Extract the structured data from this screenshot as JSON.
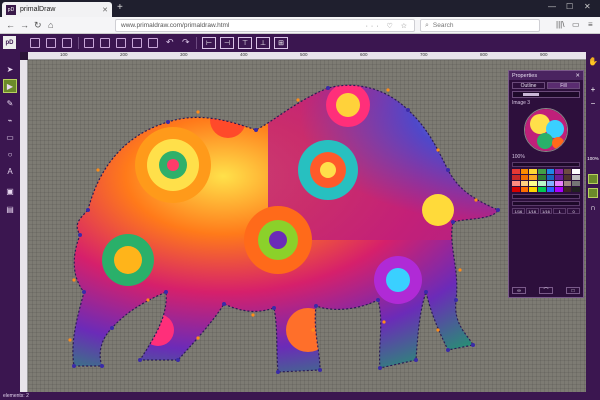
{
  "browser": {
    "tab_title": "primalDraw",
    "tab_close": "✕",
    "new_tab": "+",
    "url": "www.primaldraw.com/primaldraw.html",
    "search_placeholder": "Search",
    "url_icons": "··· ♡ ☆",
    "right_icons": [
      "|||\\",
      "▭",
      "≡"
    ],
    "window_controls": [
      "—",
      "☐",
      "✕"
    ]
  },
  "app": {
    "logo_text": "pD",
    "accent_color": "#3b1650",
    "active_tool_color": "#6b8a2a"
  },
  "ruler": {
    "top_ticks": [
      "100",
      "200",
      "300",
      "400",
      "500",
      "600",
      "700",
      "800",
      "900"
    ]
  },
  "properties": {
    "title": "Properties",
    "close": "✕",
    "tab_outline": "Outline",
    "tab_fill": "Fill",
    "image_label": "Image 3",
    "zoom_label": "100%",
    "swatch_colors": [
      "#e53935",
      "#fb8c00",
      "#fdd835",
      "#43a047",
      "#1e88e5",
      "#8e24aa",
      "#6d4c41",
      "#ffffff",
      "#c62828",
      "#ef6c00",
      "#f9a825",
      "#2e7d32",
      "#1565c0",
      "#6a1b9a",
      "#4e342e",
      "#bdbdbd",
      "#ff8a80",
      "#ffd180",
      "#ffff8d",
      "#b9f6ca",
      "#82b1ff",
      "#ea80fc",
      "#a1887f",
      "#757575",
      "#d50000",
      "#ff6d00",
      "#ffd600",
      "#00c853",
      "#2962ff",
      "#aa00ff",
      "#3e2723",
      "#212121"
    ],
    "number_fields": [
      "1/16",
      "1/16",
      "1/16",
      "1",
      "0"
    ]
  },
  "status": {
    "text": "elements: 2"
  }
}
